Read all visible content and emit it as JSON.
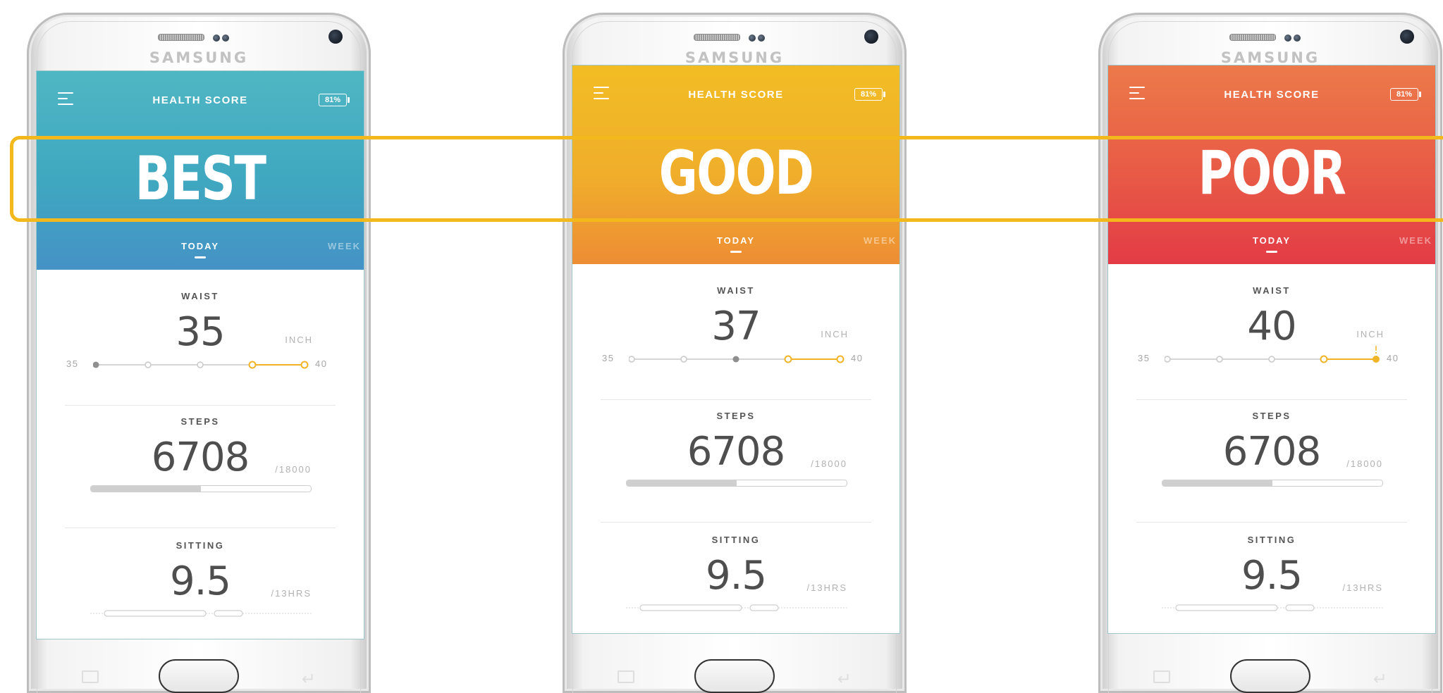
{
  "phones": [
    {
      "id": "best",
      "brand": "SAMSUNG",
      "app_title": "HEALTH SCORE",
      "battery": "81%",
      "score": "BEST",
      "tabs": {
        "today": "TODAY",
        "week": "WEEK"
      },
      "waist": {
        "label": "WAIST",
        "value": "35",
        "unit": "INCH",
        "scale_min": "35",
        "scale_max": "40"
      },
      "steps": {
        "label": "STEPS",
        "value": "6708",
        "goal": "/18000",
        "progress": 0.5
      },
      "sitting": {
        "label": "SITTING",
        "value": "9.5",
        "goal": "/13HRS"
      }
    },
    {
      "id": "good",
      "brand": "SAMSUNG",
      "app_title": "HEALTH SCORE",
      "battery": "81%",
      "score": "GOOD",
      "tabs": {
        "today": "TODAY",
        "week": "WEEK"
      },
      "waist": {
        "label": "WAIST",
        "value": "37",
        "unit": "INCH",
        "scale_min": "35",
        "scale_max": "40"
      },
      "steps": {
        "label": "STEPS",
        "value": "6708",
        "goal": "/18000",
        "progress": 0.5
      },
      "sitting": {
        "label": "SITTING",
        "value": "9.5",
        "goal": "/13HRS"
      }
    },
    {
      "id": "poor",
      "brand": "SAMSUNG",
      "app_title": "HEALTH SCORE",
      "battery": "81%",
      "score": "POOR",
      "tabs": {
        "today": "TODAY",
        "week": "WEEK"
      },
      "waist": {
        "label": "WAIST",
        "value": "40",
        "unit": "INCH",
        "scale_min": "35",
        "scale_max": "40"
      },
      "steps": {
        "label": "STEPS",
        "value": "6708",
        "goal": "/18000",
        "progress": 0.5
      },
      "sitting": {
        "label": "SITTING",
        "value": "9.5",
        "goal": "/13HRS"
      }
    }
  ],
  "colors": {
    "best_header": "#44aac2",
    "good_header": "#f0ae2b",
    "poor_header": "#e85a46",
    "highlight_frame": "#f2b81c",
    "waist_active": "#f0b429"
  },
  "icons": [
    "menu-icon",
    "battery-icon",
    "home-button",
    "recent-apps-icon",
    "back-icon"
  ]
}
